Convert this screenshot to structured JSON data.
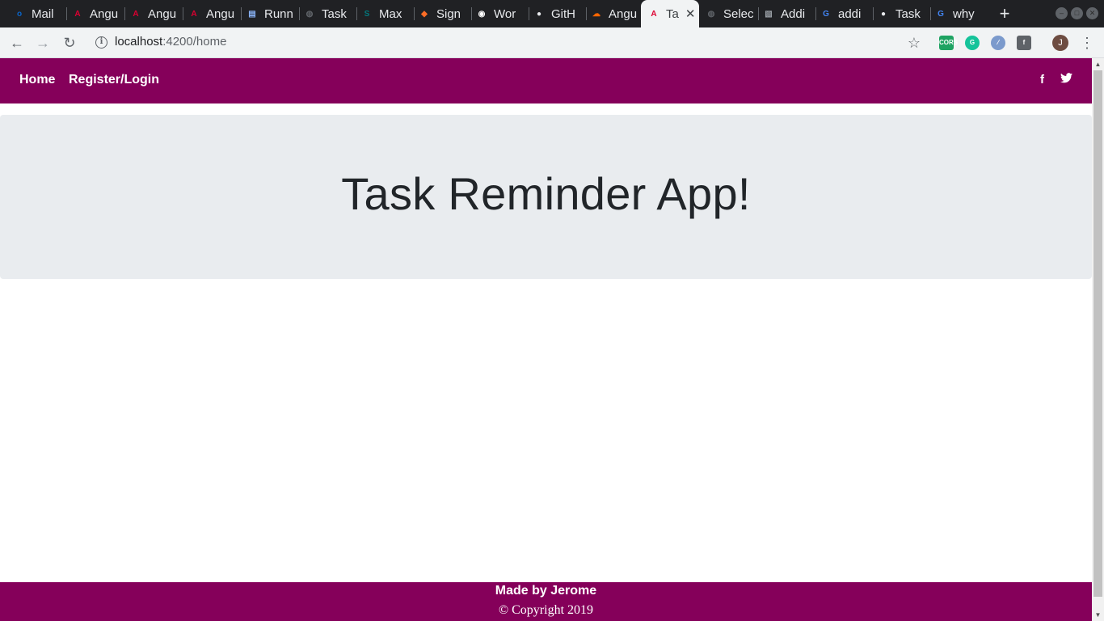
{
  "browser": {
    "tabs": [
      {
        "title": "Mail",
        "icon": "outlook-icon",
        "glyph": "o",
        "color": "#0a64c8"
      },
      {
        "title": "Angu",
        "icon": "angular-icon",
        "glyph": "A",
        "color": "#dd0031"
      },
      {
        "title": "Angu",
        "icon": "angular-icon",
        "glyph": "A",
        "color": "#dd0031"
      },
      {
        "title": "Angu",
        "icon": "angular-icon",
        "glyph": "A",
        "color": "#dd0031"
      },
      {
        "title": "Runn",
        "icon": "document-icon",
        "glyph": "▤",
        "color": "#8ab4f8"
      },
      {
        "title": "Task",
        "icon": "globe-icon",
        "glyph": "◍",
        "color": "#5f6368"
      },
      {
        "title": "Max",
        "icon": "sharepoint-icon",
        "glyph": "S",
        "color": "#03787c"
      },
      {
        "title": "Sign",
        "icon": "gitlab-icon",
        "glyph": "◆",
        "color": "#fc6d26"
      },
      {
        "title": "Wor",
        "icon": "wordpress-icon",
        "glyph": "◉",
        "color": "#ffffff"
      },
      {
        "title": "GitH",
        "icon": "github-icon",
        "glyph": "●",
        "color": "#e8eaed"
      },
      {
        "title": "Angu",
        "icon": "stackblitz-icon",
        "glyph": "☁",
        "color": "#ff6600"
      },
      {
        "title": "Ta",
        "icon": "angular-icon",
        "glyph": "A",
        "color": "#dd0031",
        "active": true
      },
      {
        "title": "Selec",
        "icon": "globe-icon",
        "glyph": "◍",
        "color": "#5f6368"
      },
      {
        "title": "Addi",
        "icon": "image-icon",
        "glyph": "▧",
        "color": "#9aa0a6"
      },
      {
        "title": "addi",
        "icon": "google-icon",
        "glyph": "G",
        "color": "#4285f4"
      },
      {
        "title": "Task",
        "icon": "github-icon",
        "glyph": "●",
        "color": "#e8eaed"
      },
      {
        "title": "why",
        "icon": "google-icon",
        "glyph": "G",
        "color": "#4285f4"
      }
    ],
    "address": {
      "host": "localhost",
      "path": ":4200/home"
    },
    "extensions": [
      {
        "name": "cors-extension-icon",
        "label": "CORS",
        "color": "#1ea362"
      },
      {
        "name": "grammarly-icon",
        "label": "G",
        "color": "#15c39a"
      },
      {
        "name": "feather-extension-icon",
        "label": "⁄",
        "color": "#7b9acc"
      },
      {
        "name": "facebook-extension-icon",
        "label": "f",
        "color": "#5f6368"
      }
    ],
    "profile_initial": "J"
  },
  "page": {
    "nav": {
      "home": "Home",
      "register": "Register/Login"
    },
    "social": {
      "facebook": "f",
      "twitter": "🐦"
    },
    "heading": "Task Reminder App!",
    "footer": {
      "made_by": "Made by Jerome",
      "copyright": "© Copyright 2019"
    }
  }
}
